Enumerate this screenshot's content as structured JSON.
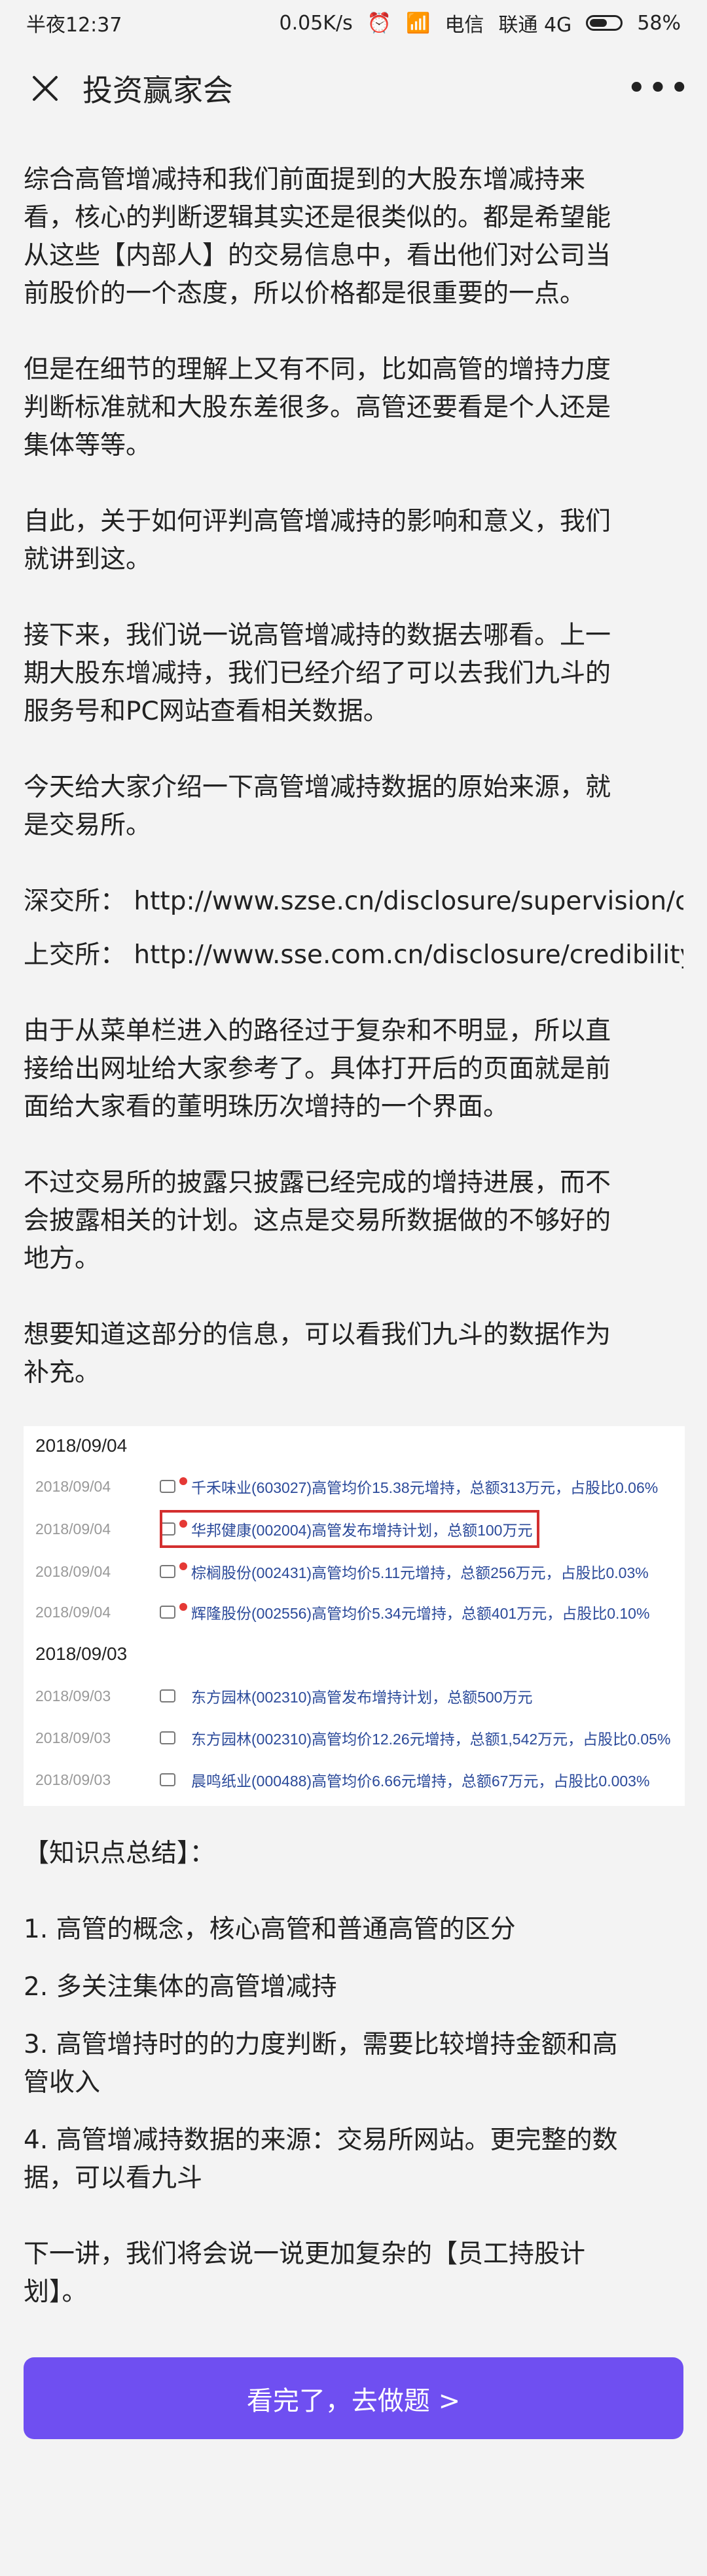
{
  "status": {
    "time": "半夜12:37",
    "net": "0.05K/s",
    "carrier1": "电信",
    "carrier2": "联通 4G",
    "battery": "58%"
  },
  "header": {
    "title": "投资赢家会"
  },
  "paragraphs": [
    "综合高管增减持和我们前面提到的大股东增减持来\n看，核心的判断逻辑其实还是很类似的。都是希望能\n从这些【内部人】的交易信息中，看出他们对公司当\n前股价的一个态度，所以价格都是很重要的一点。",
    "但是在细节的理解上又有不同，比如高管的增持力度\n判断标准就和大股东差很多。高管还要看是个人还是\n集体等等。",
    "自此，关于如何评判高管增减持的影响和意义，我们\n就讲到这。",
    "接下来，我们说一说高管增减持的数据去哪看。上一\n期大股东增减持，我们已经介绍了可以去我们九斗的\n服务号和PC网站查看相关数据。",
    "今天给大家介绍一下高管增减持数据的原始来源，就\n是交易所。",
    "深交所：\nhttp://www.szse.cn/disclosure/supervision/change/ir",
    "上交所：\nhttp://www.sse.com.cn/disclosure/credibility/supervis",
    "由于从菜单栏进入的路径过于复杂和不明显，所以直\n接给出网址给大家参考了。具体打开后的页面就是前\n面给大家看的董明珠历次增持的一个界面。",
    "不过交易所的披露只披露已经完成的增持进展，而不\n会披露相关的计划。这点是交易所数据做的不够好的\n地方。",
    "想要知道这部分的信息，可以看我们九斗的数据作为\n补充。"
  ],
  "table": {
    "date1": "2018/09/04",
    "date2": "2018/09/03",
    "rows": [
      {
        "date": "2018/09/04",
        "text": "千禾味业(603027)高管均价15.38元增持，总额313万元，占股比0.06%",
        "dot": true
      },
      {
        "date": "2018/09/04",
        "text": "华邦健康(002004)高管发布增持计划，总额100万元",
        "dot": true
      },
      {
        "date": "2018/09/04",
        "text": "棕榈股份(002431)高管均价5.11元增持，总额256万元，占股比0.03%",
        "dot": true
      },
      {
        "date": "2018/09/04",
        "text": "辉隆股份(002556)高管均价5.34元增持，总额401万元，占股比0.10%",
        "dot": true
      },
      {
        "date": "2018/09/03",
        "text": "东方园林(002310)高管发布增持计划，总额500万元",
        "dot": false
      },
      {
        "date": "2018/09/03",
        "text": "东方园林(002310)高管均价12.26元增持，总额1,542万元，占股比0.05%",
        "dot": false
      },
      {
        "date": "2018/09/03",
        "text": "晨鸣纸业(000488)高管均价6.66元增持，总额67万元，占股比0.003%",
        "dot": false
      }
    ]
  },
  "summary": [
    "【知识点总结】：",
    "1. 高管的概念，核心高管和普通高管的区分",
    "2. 多关注集体的高管增减持",
    "3. 高管增持时的的力度判断，需要比较增持金额和高\n管收入",
    "4. 高管增减持数据的来源：交易所网站。更完整的数\n据，可以看九斗",
    "下一讲，我们将会说一说更加复杂的【员工持股计\n划】。"
  ],
  "button": {
    "label": "看完了，去做题 >"
  },
  "colors": {
    "accent": "#6f4ff1",
    "link": "#2b4a9a",
    "highlight": "#d32f2f"
  }
}
